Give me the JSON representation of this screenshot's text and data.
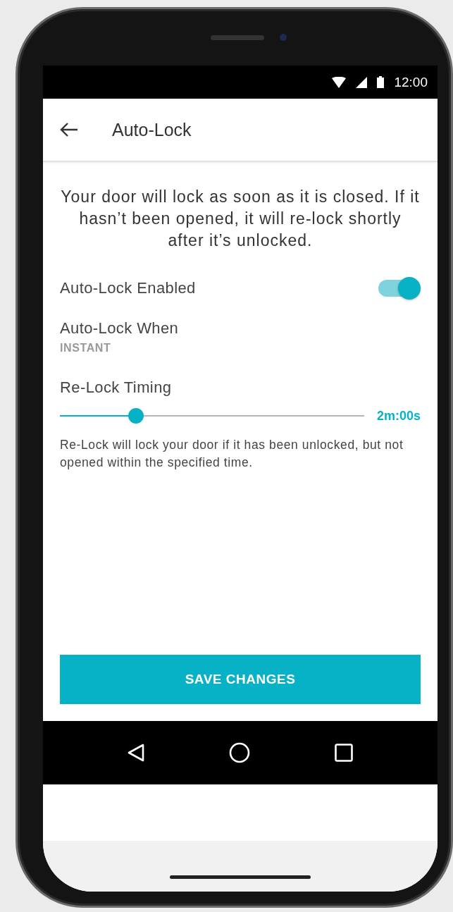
{
  "status_bar": {
    "time": "12:00"
  },
  "app_bar": {
    "title": "Auto-Lock"
  },
  "description": "Your door will lock as soon as it is closed. If it hasn’t been opened, it will re-lock shortly after it’s unlocked.",
  "settings": [
    {
      "kind": "toggle",
      "label": "Auto-Lock Enabled",
      "on": true
    },
    {
      "kind": "choice",
      "label": "Auto-Lock When",
      "value": "INSTANT"
    },
    {
      "kind": "slider",
      "label": "Re-Lock Timing",
      "level": 0.25,
      "reading": "2m:00s",
      "note": "Re-Lock will lock your door if it has been unlocked, but not opened within the specified time."
    }
  ],
  "save_button": "SAVE CHANGES"
}
